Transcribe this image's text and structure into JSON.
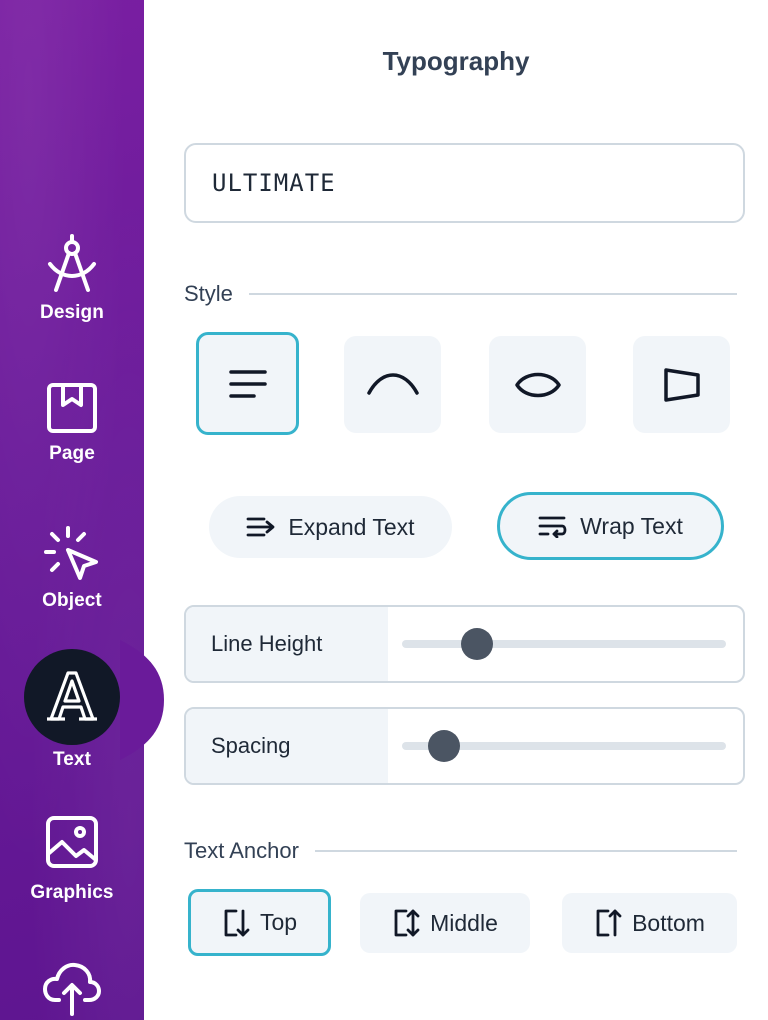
{
  "sidebar": {
    "items": [
      {
        "label": "Design",
        "icon": "compass-icon"
      },
      {
        "label": "Page",
        "icon": "bookmark-page-icon"
      },
      {
        "label": "Object",
        "icon": "cursor-click-icon"
      },
      {
        "label": "Text",
        "icon": "letter-a-icon",
        "active": true
      },
      {
        "label": "Graphics",
        "icon": "image-icon"
      },
      {
        "label": "",
        "icon": "cloud-upload-icon"
      }
    ],
    "accent": "#6a1b9a",
    "active_bg": "#111827"
  },
  "panel": {
    "title": "Typography",
    "text_input": {
      "value": "ULTIMATE"
    },
    "style": {
      "label": "Style",
      "options": [
        {
          "icon": "align-left-lines-icon",
          "active": true
        },
        {
          "icon": "arc-curve-icon",
          "active": false
        },
        {
          "icon": "lens-shape-icon",
          "active": false
        },
        {
          "icon": "perspective-shape-icon",
          "active": false
        }
      ]
    },
    "modes": [
      {
        "label": "Expand Text",
        "icon": "expand-text-icon",
        "active": false
      },
      {
        "label": "Wrap Text",
        "icon": "wrap-text-icon",
        "active": true
      }
    ],
    "sliders": [
      {
        "label": "Line Height",
        "value": 0.23
      },
      {
        "label": "Spacing",
        "value": 0.13
      }
    ],
    "anchor": {
      "label": "Text Anchor",
      "options": [
        {
          "label": "Top",
          "icon": "anchor-top-icon",
          "active": true
        },
        {
          "label": "Middle",
          "icon": "anchor-middle-icon",
          "active": false
        },
        {
          "label": "Bottom",
          "icon": "anchor-bottom-icon",
          "active": false
        }
      ]
    }
  },
  "colors": {
    "active_border": "#36b3cc",
    "control_bg": "#f1f5f9",
    "border": "#cfd8e0"
  }
}
